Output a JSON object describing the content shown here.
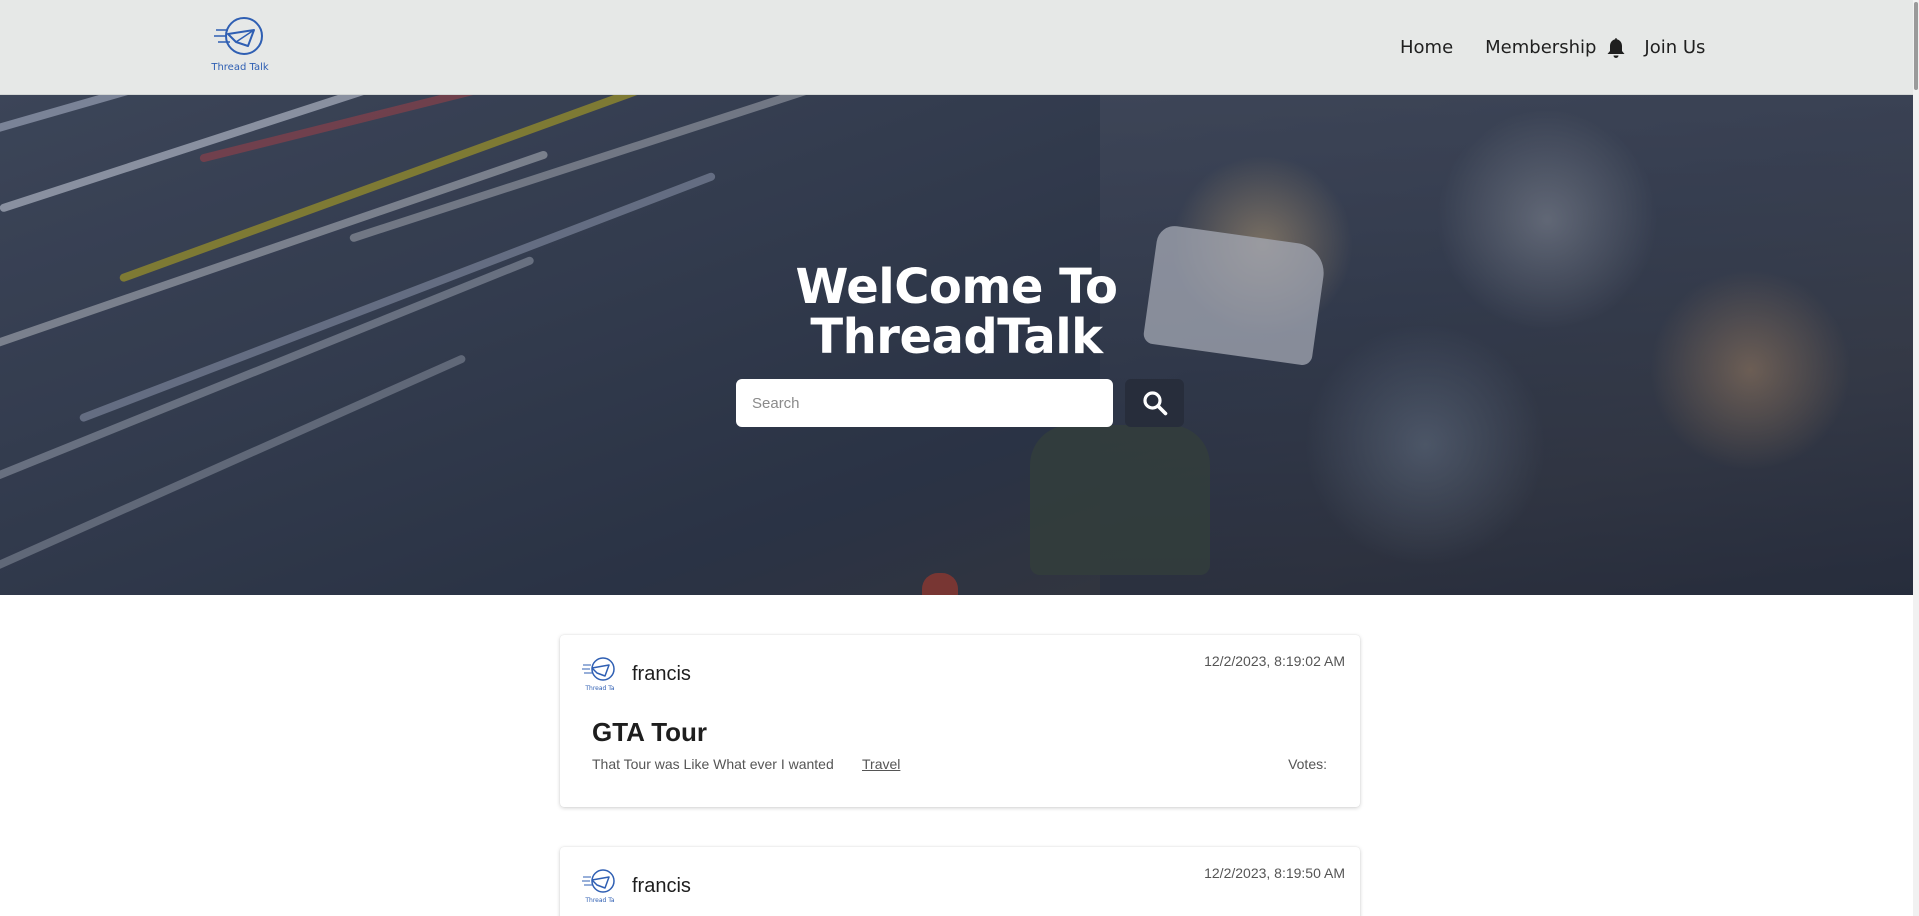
{
  "brand": {
    "logo_text": "Thread Talk",
    "accent": "#2f5fb3"
  },
  "nav": {
    "links": [
      "Home",
      "Membership",
      "Join Us"
    ],
    "icons": [
      "bell-icon"
    ]
  },
  "hero": {
    "title_line1": "WelCome To",
    "title_line2": "ThreadTalk",
    "search_placeholder": "Search",
    "search_icon": "search-icon"
  },
  "posts": [
    {
      "author": "francis",
      "timestamp": "12/2/2023, 8:19:02 AM",
      "title": "GTA Tour",
      "body": "That Tour was Like What ever I wanted",
      "category": "Travel",
      "votes_label": "Votes:"
    },
    {
      "author": "francis",
      "timestamp": "12/2/2023, 8:19:50 AM"
    }
  ],
  "colors": {
    "navbar_bg": "#e6e8e7",
    "search_button_bg": "#272d3b",
    "hero_text": "#ffffff"
  }
}
